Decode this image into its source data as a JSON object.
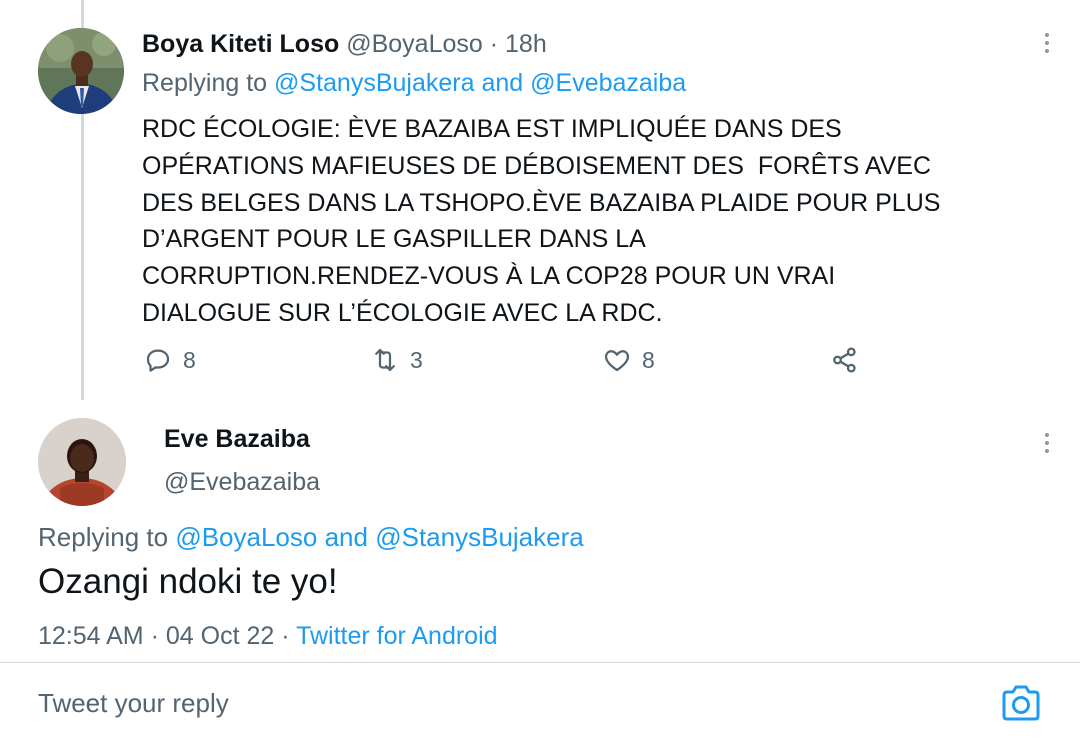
{
  "tweet1": {
    "name": "Boya Kiteti Loso",
    "handle": "@BoyaLoso",
    "separator": "·",
    "time": "18h",
    "replying_prefix": "Replying to",
    "replying_user1": "@StanysBujakera",
    "replying_and": "and",
    "replying_user2": "@Evebazaiba",
    "body_lines": [
      "RDC ÉCOLOGIE: ÈVE BAZAIBA EST IMPLIQUÉE DANS DES",
      "OPÉRATIONS MAFIEUSES DE DÉBOISEMENT DES  FORÊTS AVEC",
      "DES BELGES DANS LA TSHOPO.ÈVE BAZAIBA PLAIDE POUR PLUS",
      "D’ARGENT POUR LE GASPILLER DANS LA",
      "CORRUPTION.RENDEZ-VOUS À LA COP28 POUR UN VRAI",
      "DIALOGUE SUR L’ÉCOLOGIE AVEC LA RDC."
    ],
    "reply_count": "8",
    "retweet_count": "3",
    "like_count": "8"
  },
  "tweet2": {
    "name": "Eve Bazaiba",
    "handle": "@Evebazaiba",
    "replying_prefix": "Replying to",
    "replying_user1": "@BoyaLoso",
    "replying_and": "and",
    "replying_user2": "@StanysBujakera",
    "text": "Ozangi ndoki te yo!",
    "time": "12:54 AM",
    "date": "04 Oct 22",
    "separator": "·",
    "source": "Twitter for Android"
  },
  "reply_bar": {
    "placeholder": "Tweet your reply"
  },
  "icons": {
    "reply": "comment-icon",
    "retweet": "retweet-icon",
    "like": "heart-icon",
    "share": "share-icon",
    "more": "more-vertical-icon",
    "camera": "camera-icon"
  },
  "colors": {
    "link": "#1d9bf0",
    "muted": "#536471",
    "text": "#0f1419",
    "border": "#cfd9de"
  }
}
